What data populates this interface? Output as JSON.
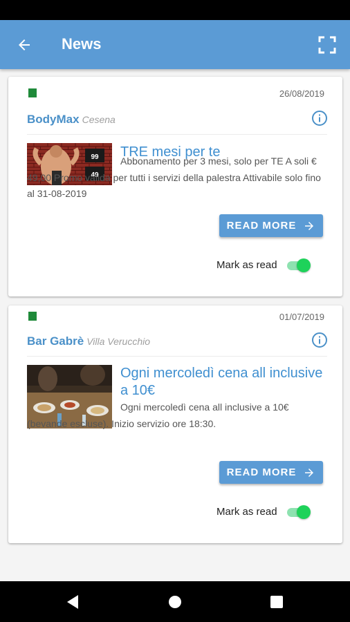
{
  "app_bar": {
    "title": "News",
    "color": "#5b9bd5"
  },
  "icons": {
    "back": "arrow-left-icon",
    "fullscreen": "fullscreen-icon",
    "info": "info-circle-icon",
    "read_more_arrow": "arrow-right-icon",
    "nav_back": "triangle-back-icon",
    "nav_home": "circle-home-icon",
    "nav_recents": "square-recents-icon"
  },
  "news": [
    {
      "date": "26/08/2019",
      "merchant": "BodyMax",
      "city": "Cesena",
      "headline": "TRE mesi per te",
      "body": "Abbonamento per 3 mesi, solo per TE A soli € 49,00 Promo valida per tutti i servizi della palestra Attivabile solo fino al 31-08-2019",
      "read_more": "READ MORE",
      "mark_as_read": "Mark as read",
      "is_read": true
    },
    {
      "date": "01/07/2019",
      "merchant": "Bar Gabrè",
      "city": "Villa Verucchio",
      "headline": "Ogni mercoledì cena all inclusive a 10€",
      "body": "Ogni mercoledì cena all inclusive a 10€ (bevande escluse). Inizio servizio ore 18:30.",
      "read_more": "READ MORE",
      "mark_as_read": "Mark as read",
      "is_read": true
    }
  ],
  "colors": {
    "accent": "#4a90c8",
    "toggle_on": "#1ed25a",
    "flag": "#1f8a3a"
  }
}
